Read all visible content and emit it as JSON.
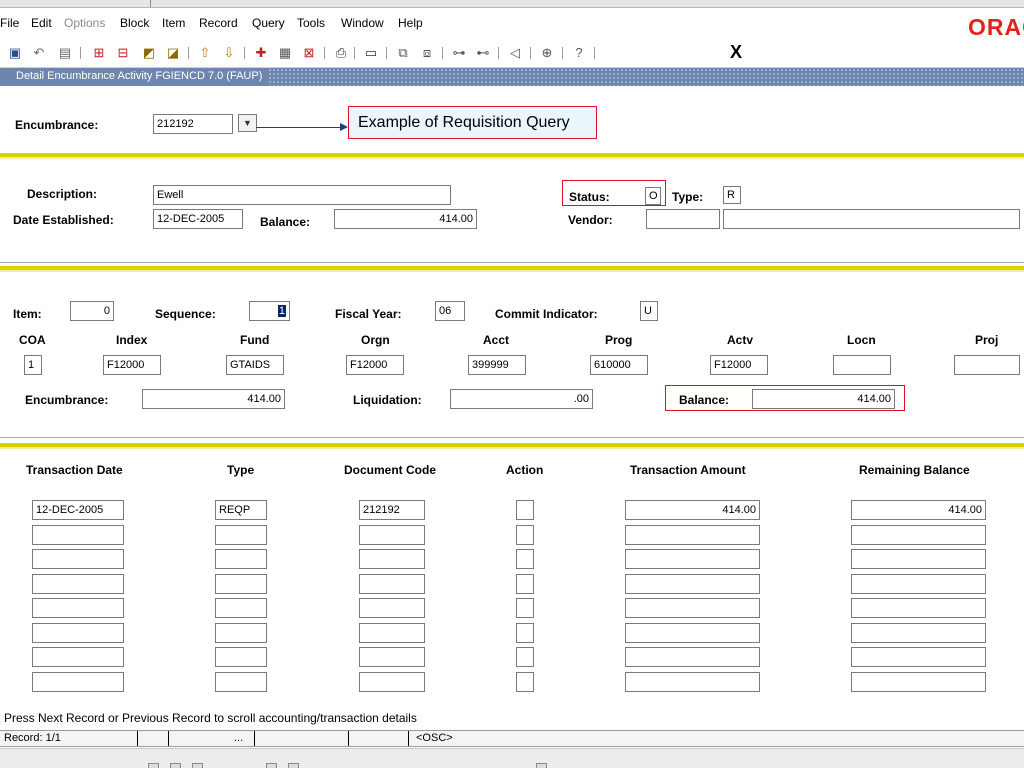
{
  "menu": {
    "items": [
      "File",
      "Edit",
      "Options",
      "Block",
      "Item",
      "Record",
      "Query",
      "Tools",
      "Window",
      "Help"
    ],
    "disabled": [
      "Options"
    ],
    "logo_text": "ORACLE"
  },
  "toolbar": {
    "icons": [
      "save-icon",
      "rollback-icon",
      "select-icon",
      "insert-record-icon",
      "remove-record-icon",
      "previous-block-icon",
      "next-block-icon",
      "up-icon",
      "down-icon",
      "help-icon",
      "query-icon",
      "cancel-query-icon",
      "print-icon",
      "print-setup-icon",
      "copy-icon",
      "paste-icon",
      "tree-icon",
      "tree2-icon",
      "speaker-icon",
      "globe-icon",
      "help-circle-icon"
    ],
    "exit_label": "X"
  },
  "window": {
    "title": "Detail Encumbrance Activity  FGIENCD  7.0  (FAUP)"
  },
  "key_block": {
    "encumbrance_label": "Encumbrance:",
    "encumbrance_value": "212192",
    "callout": "Example of Requisition Query"
  },
  "header": {
    "description_label": "Description:",
    "description_value": "Ewell",
    "date_label": "Date Established:",
    "date_value": "12-DEC-2005",
    "balance_label": "Balance:",
    "balance_value": "414.00",
    "status_label": "Status:",
    "status_value": "O",
    "type_label": "Type:",
    "type_value": "R",
    "vendor_label": "Vendor:",
    "vendor_id": "",
    "vendor_name": ""
  },
  "accounting": {
    "item_label": "Item:",
    "item_value": "0",
    "sequence_label": "Sequence:",
    "sequence_value": "1",
    "fiscal_year_label": "Fiscal Year:",
    "fiscal_year_value": "06",
    "commit_label": "Commit Indicator:",
    "commit_value": "U",
    "columns": [
      "COA",
      "Index",
      "Fund",
      "Orgn",
      "Acct",
      "Prog",
      "Actv",
      "Locn",
      "Proj"
    ],
    "values": [
      "1",
      "F12000",
      "GTAIDS",
      "F12000",
      "399999",
      "610000",
      "F12000",
      "",
      ""
    ],
    "encumbrance_label": "Encumbrance:",
    "encumbrance_value": "414.00",
    "liquidation_label": "Liquidation:",
    "liquidation_value": ".00",
    "balance_label": "Balance:",
    "balance_value": "414.00"
  },
  "transactions": {
    "columns": [
      "Transaction Date",
      "Type",
      "Document Code",
      "Action",
      "Transaction Amount",
      "Remaining Balance"
    ],
    "rows": [
      [
        "12-DEC-2005",
        "REQP",
        "212192",
        "",
        "414.00",
        "414.00"
      ],
      [
        "",
        "",
        "",
        "",
        "",
        ""
      ],
      [
        "",
        "",
        "",
        "",
        "",
        ""
      ],
      [
        "",
        "",
        "",
        "",
        "",
        ""
      ],
      [
        "",
        "",
        "",
        "",
        "",
        ""
      ],
      [
        "",
        "",
        "",
        "",
        "",
        ""
      ],
      [
        "",
        "",
        "",
        "",
        "",
        ""
      ],
      [
        "",
        "",
        "",
        "",
        "",
        ""
      ]
    ]
  },
  "hint": "Press Next Record or Previous Record to scroll accounting/transaction details",
  "status_bar": {
    "record": "Record: 1/1",
    "dots": "...",
    "mode": "<OSC>"
  },
  "colors": {
    "accent_red": "#e0102a",
    "separator_yellow": "#d8d000",
    "title_blue": "#6e86ad",
    "callout_bg": "#eaf6fc"
  }
}
